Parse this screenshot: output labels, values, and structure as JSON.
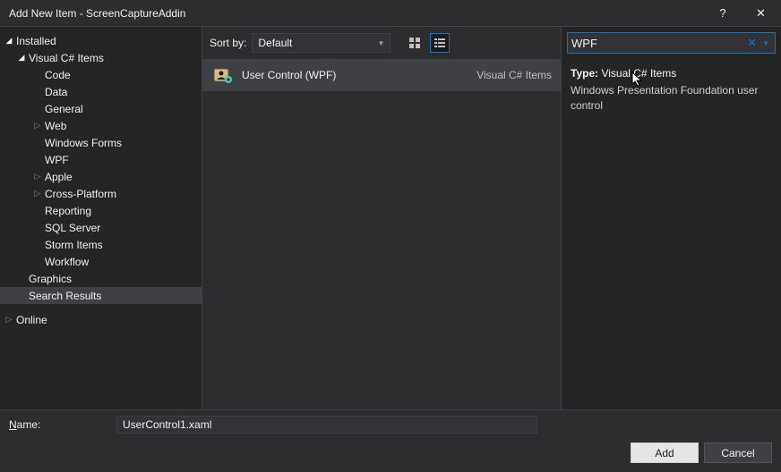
{
  "window": {
    "title": "Add New Item - ScreenCaptureAddin",
    "help": "?",
    "close": "✕"
  },
  "sidebar": {
    "installed": "Installed",
    "root": "Visual C# Items",
    "children": [
      "Code",
      "Data",
      "General",
      "Web",
      "Windows Forms",
      "WPF",
      "Apple",
      "Cross-Platform",
      "Reporting",
      "SQL Server",
      "Storm Items",
      "Workflow"
    ],
    "childHasArrow": [
      false,
      false,
      false,
      true,
      false,
      false,
      true,
      true,
      false,
      false,
      false,
      false
    ],
    "graphics": "Graphics",
    "searchResults": "Search Results",
    "online": "Online"
  },
  "topbar": {
    "sortLabel": "Sort by:",
    "sortValue": "Default"
  },
  "items": [
    {
      "name": "User Control (WPF)",
      "category": "Visual C# Items"
    }
  ],
  "search": {
    "value": "WPF"
  },
  "details": {
    "typeLabel": "Type:",
    "typeValue": "Visual C# Items",
    "description": "Windows Presentation Foundation user control"
  },
  "bottom": {
    "nameLabel": "Name:",
    "nameValue": "UserControl1.xaml",
    "add": "Add",
    "cancel": "Cancel"
  }
}
